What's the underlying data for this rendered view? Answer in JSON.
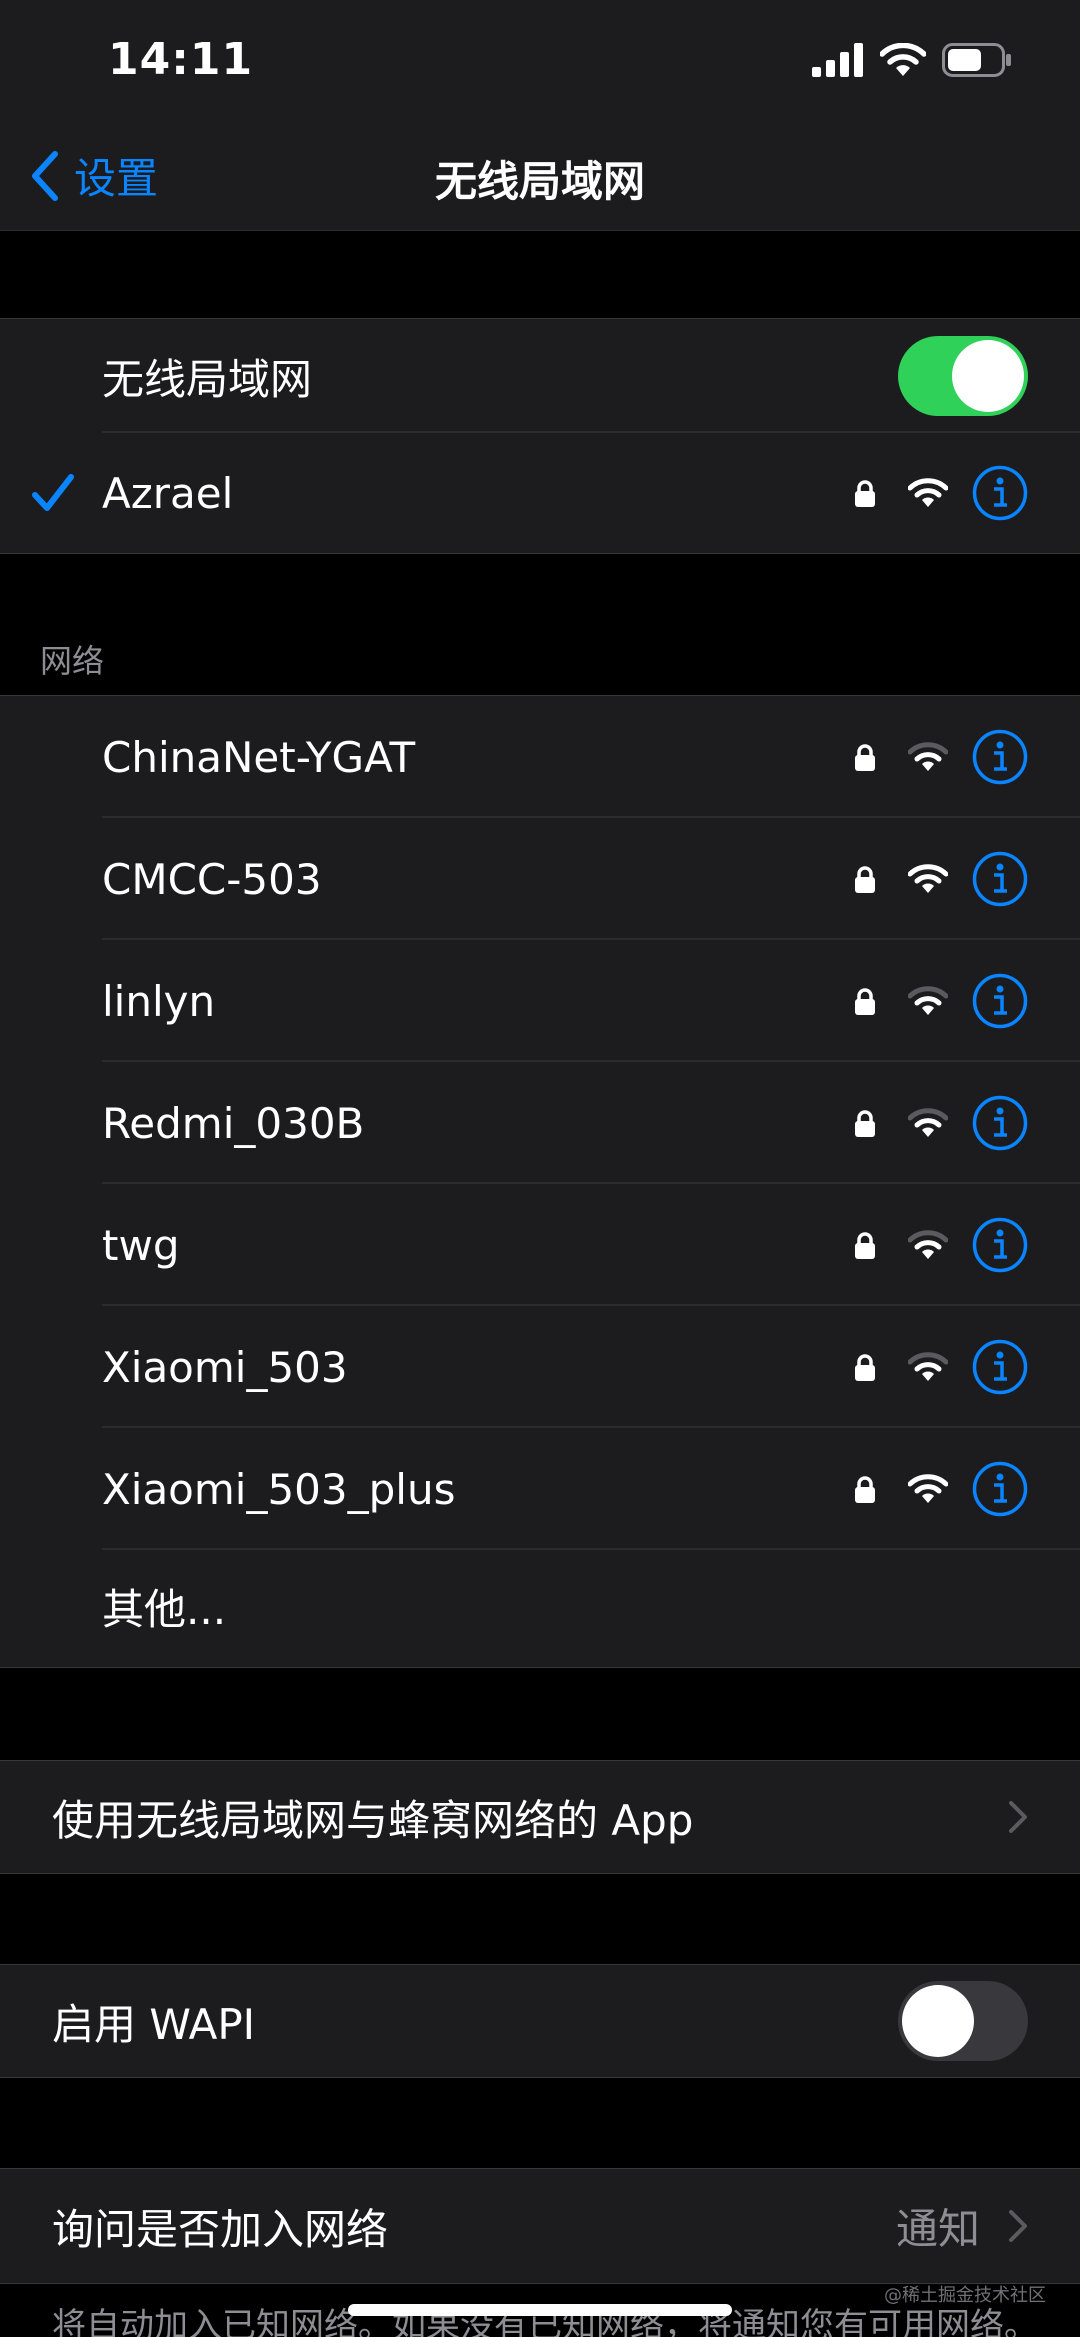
{
  "status_bar": {
    "time": "14:11"
  },
  "nav": {
    "back_label": "设置",
    "title": "无线局域网"
  },
  "wifi": {
    "toggle_label": "无线局域网",
    "toggle_on": true,
    "connected": "Azrael"
  },
  "networks": {
    "header": "网络",
    "items": [
      {
        "name": "ChinaNet-YGAT",
        "secured": true,
        "signal": "medium"
      },
      {
        "name": "CMCC-503",
        "secured": true,
        "signal": "full"
      },
      {
        "name": "linlyn",
        "secured": true,
        "signal": "medium"
      },
      {
        "name": "Redmi_030B",
        "secured": true,
        "signal": "medium"
      },
      {
        "name": "twg",
        "secured": true,
        "signal": "medium"
      },
      {
        "name": "Xiaomi_503",
        "secured": true,
        "signal": "medium"
      },
      {
        "name": "Xiaomi_503_plus",
        "secured": true,
        "signal": "full"
      }
    ],
    "other": "其他..."
  },
  "apps_row": {
    "label": "使用无线局域网与蜂窝网络的 App"
  },
  "wapi": {
    "label": "启用 WAPI",
    "enabled": false
  },
  "ask_join": {
    "label": "询问是否加入网络",
    "value": "通知"
  },
  "footer": {
    "text": "将自动加入已知网络。如果没有已知网络，将通知您有可用网络。"
  },
  "watermark": "@稀土掘金技术社区",
  "colors": {
    "accent": "#0a84ff",
    "toggle_on": "#30d158",
    "cell_bg": "#1c1c1e",
    "page_bg": "#000000"
  }
}
